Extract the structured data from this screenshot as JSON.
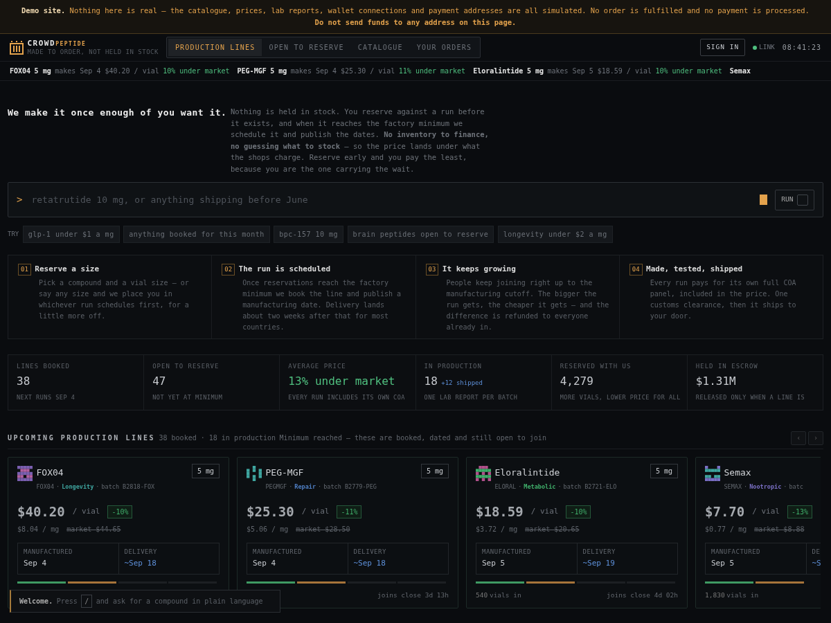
{
  "banner": {
    "lead": "Demo site.",
    "line1": "Nothing here is real — the catalogue, prices, lab reports, wallet connections and payment addresses are all simulated. No order is fulfilled and no payment is processed.",
    "line2": "Do not send funds to any address on this page."
  },
  "brand": {
    "name": "CROWD",
    "suffix": "PEPTIDE",
    "tagline": "MADE TO ORDER, NOT HELD IN STOCK"
  },
  "tabs": [
    {
      "label": "PRODUCTION LINES",
      "selected": true
    },
    {
      "label": "OPEN TO RESERVE",
      "selected": false
    },
    {
      "label": "CATALOGUE",
      "selected": false
    },
    {
      "label": "YOUR ORDERS",
      "selected": false
    }
  ],
  "header": {
    "sign_in": "SIGN IN",
    "link": {
      "label": "LINK",
      "on": true
    },
    "clock": "08:41:23"
  },
  "ticker": [
    {
      "name": "FOX04",
      "dose": "5 mg",
      "makes": "makes Sep 4 $40.20 / vial",
      "saving": "10% under market"
    },
    {
      "name": "PEG-MGF",
      "dose": "5 mg",
      "makes": "makes Sep 4 $25.30 / vial",
      "saving": "11% under market"
    },
    {
      "name": "Eloralintide",
      "dose": "5 mg",
      "makes": "makes Sep 5 $18.59 / vial",
      "saving": "10% under market"
    },
    {
      "name": "Semax"
    }
  ],
  "hero": {
    "title": "We make it once enough of you want it.",
    "body": "Nothing is held in stock. You reserve against a run before it exists, and when it reaches the factory minimum we schedule it and publish the dates. **No inventory to finance, no guessing what to stock** — so the price lands under what the shops charge. Reserve early and you pay the least, because you are the one carrying the wait."
  },
  "search": {
    "prompt": ">",
    "placeholder": "retatrutide 10 mg, or anything shipping before June",
    "button": "RUN"
  },
  "suggestions": {
    "label": "TRY",
    "items": [
      "glp-1 under $1 a mg",
      "anything booked for this month",
      "bpc-157 10 mg",
      "brain peptides open to reserve",
      "longevity under $2 a mg"
    ]
  },
  "steps": [
    {
      "number": "01",
      "title": "Reserve a size",
      "body": "Pick a compound and a vial size — or say any size and we place you in whichever run schedules first, for a little more off."
    },
    {
      "number": "02",
      "title": "The run is scheduled",
      "body": "Once reservations reach the factory minimum we book the line and publish a manufacturing date. Delivery lands about two weeks after that for most countries."
    },
    {
      "number": "03",
      "title": "It keeps growing",
      "body": "People keep joining right up to the manufacturing cutoff. The bigger the run gets, the cheaper it gets — and the difference is refunded to everyone already in."
    },
    {
      "number": "04",
      "title": "Made, tested, shipped",
      "body": "Every run pays for its own full COA panel, included in the price. One customs clearance, then it ships to your door."
    }
  ],
  "stats": [
    {
      "label": "LINES BOOKED",
      "value": "38",
      "note": "NEXT RUNS SEP 4",
      "highlighted": false
    },
    {
      "label": "OPEN TO RESERVE",
      "value": "47",
      "note": "NOT YET AT MINIMUM",
      "highlighted": false
    },
    {
      "label": "AVERAGE PRICE",
      "value": "13% under market",
      "note": "EVERY RUN INCLUDES ITS OWN COA",
      "highlighted": true
    },
    {
      "label": "IN PRODUCTION",
      "value": "18",
      "extra": "+12 shipped",
      "note": "ONE LAB REPORT PER BATCH",
      "highlighted": false
    },
    {
      "label": "RESERVED WITH US",
      "value": "4,279",
      "note": "MORE VIALS, LOWER PRICE FOR ALL",
      "highlighted": false
    },
    {
      "label": "HELD IN ESCROW",
      "value": "$1.31M",
      "note": "RELEASED ONLY WHEN A LINE IS",
      "highlighted": false
    }
  ],
  "section": {
    "title": "UPCOMING PRODUCTION LINES",
    "meta": "38 booked · 18 in production",
    "note": "Minimum reached — these are booked, dated and still open to join",
    "prev": "‹",
    "next": "›",
    "separator": "·"
  },
  "lines": [
    {
      "name": "FOX04",
      "dose": "5 mg",
      "code": "FOX04",
      "category": "Longevity",
      "color": "#3fa6a0",
      "batch": "batch B2818-FOX",
      "price": "$40.20",
      "unit": "/ vial",
      "discount": "-10%",
      "per_mg": "$8.04 / mg",
      "market": "market $44.65",
      "made_label": "MANUFACTURED",
      "made": "Sep 4",
      "delivery_label": "DELIVERY",
      "delivery": "~Sep 18",
      "segments": [
        {
          "color": "#3f9a63"
        },
        {
          "color": "#a7743a"
        },
        {
          "color": "#1c1f23"
        },
        {
          "color": "#1c1f23"
        }
      ]
    },
    {
      "name": "PEG-MGF",
      "dose": "5 mg",
      "code": "PEGMGF",
      "category": "Repair",
      "color": "#4f7fc4",
      "batch": "batch B2779-PEG",
      "price": "$25.30",
      "unit": "/ vial",
      "discount": "-11%",
      "per_mg": "$5.06 / mg",
      "market": "market $28.50",
      "made_label": "MANUFACTURED",
      "made": "Sep 4",
      "delivery_label": "DELIVERY",
      "delivery": "~Sep 18",
      "segments": [
        {
          "color": "#3f9a63"
        },
        {
          "color": "#a7743a"
        },
        {
          "color": "#1c1f23"
        },
        {
          "color": "#1c1f23"
        }
      ],
      "closes": "joins close 3d 13h"
    },
    {
      "name": "Eloralintide",
      "dose": "5 mg",
      "code": "ELORAL",
      "category": "Metabolic",
      "color": "#3fae6a",
      "batch": "batch B2721-ELO",
      "price": "$18.59",
      "unit": "/ vial",
      "discount": "-10%",
      "per_mg": "$3.72 / mg",
      "market": "market $20.65",
      "made_label": "MANUFACTURED",
      "made": "Sep 5",
      "delivery_label": "DELIVERY",
      "delivery": "~Sep 19",
      "segments": [
        {
          "color": "#3f9a63"
        },
        {
          "color": "#a7743a"
        },
        {
          "color": "#1c1f23"
        },
        {
          "color": "#1c1f23"
        }
      ],
      "vials": "540",
      "vials_label": "vials in",
      "closes": "joins close 4d 02h"
    },
    {
      "name": "Semax",
      "code": "SEMAX",
      "category": "Nootropic",
      "color": "#7a6fc4",
      "batch": "batc",
      "price": "$7.70",
      "unit": "/ vial",
      "discount": "-13%",
      "per_mg": "$0.77 / mg",
      "market": "market $8.88",
      "made_label": "MANUFACTURED",
      "made": "Sep 5",
      "delivery_label": "DE",
      "delivery": "~S",
      "segments": [
        {
          "color": "#3f9a63"
        },
        {
          "color": "#a7743a"
        }
      ],
      "vials": "1,830",
      "vials_label": "vials in"
    }
  ],
  "toast": {
    "title": "Welcome.",
    "lead": "Press",
    "key": "/",
    "rest": "and ask for a compound in plain language"
  }
}
